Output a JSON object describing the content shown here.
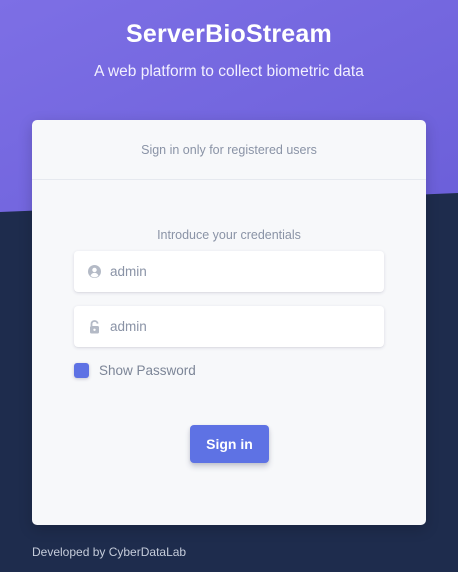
{
  "header": {
    "title": "ServerBioStream",
    "subtitle": "A web platform to collect biometric data"
  },
  "card": {
    "header_text": "Sign in only for registered users",
    "credentials_label": "Introduce your credentials",
    "username": {
      "value": "admin",
      "icon": "user-circle-icon"
    },
    "password": {
      "value": "admin",
      "icon": "lock-icon"
    },
    "show_password": {
      "label": "Show Password",
      "checked": true
    },
    "signin_label": "Sign in"
  },
  "footer": {
    "text": "Developed by CyberDataLab"
  },
  "colors": {
    "gradient_start": "#7b6fe4",
    "gradient_end": "#6a5fe0",
    "background_dark": "#1e2c4d",
    "accent": "#5e72e4",
    "card_bg": "#f7f8fa",
    "muted_text": "#8a93a6"
  }
}
